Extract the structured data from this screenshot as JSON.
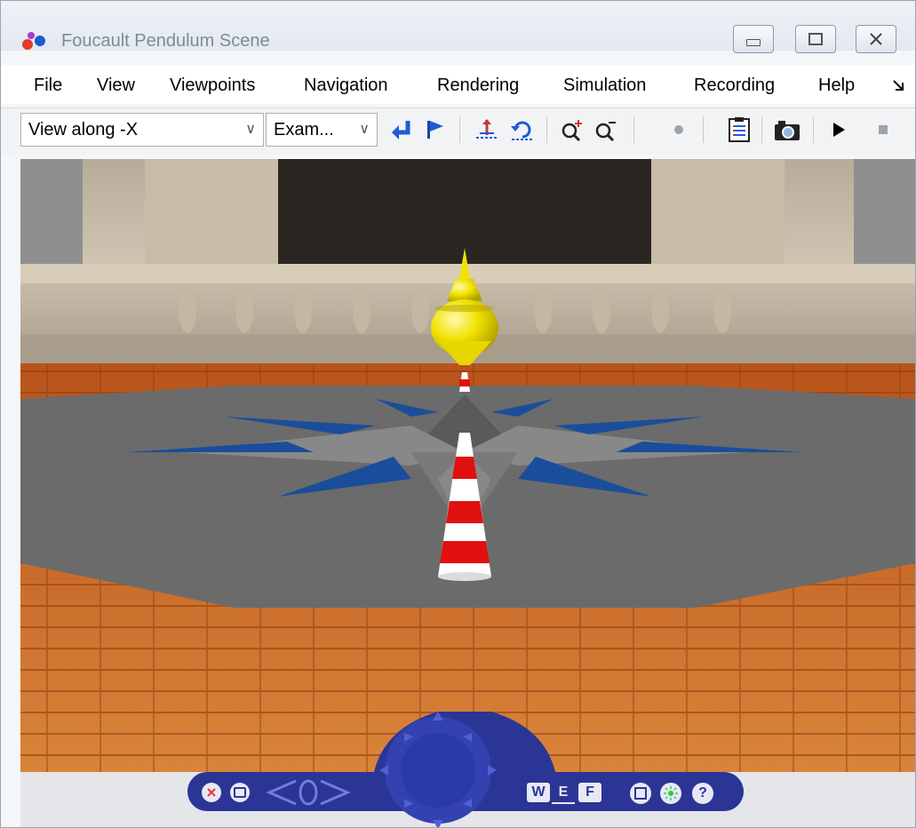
{
  "window": {
    "title": "Foucault Pendulum Scene"
  },
  "menu": {
    "items": [
      "File",
      "View",
      "Viewpoints",
      "Navigation",
      "Rendering",
      "Simulation",
      "Recording",
      "Help"
    ],
    "overflow_icon": "double-chevron-icon"
  },
  "toolbar": {
    "viewpoint_combo": "View along -X",
    "nav_mode_combo": "Exam...",
    "buttons": [
      "return-to-viewpoint",
      "create-viewpoint",
      "straighten-up",
      "undo-move",
      "zoom-in",
      "zoom-out",
      "record",
      "block-diagram",
      "capture-frame",
      "start-simulation",
      "stop-simulation"
    ]
  },
  "navigation_panel": {
    "buttons": [
      "close",
      "minimize",
      "rotate-left",
      "rotate-right",
      "w",
      "e",
      "f",
      "frame",
      "headlight",
      "help"
    ],
    "letters": {
      "w": "W",
      "e": "E",
      "f": "F",
      "help": "?"
    }
  },
  "colors": {
    "window_border": "#9aa4b0",
    "toolbar_blue": "#1f5bd6",
    "nav_panel": "#2b3596",
    "floor": "#c8641e",
    "platform": "#6b6b6b",
    "bob": "#f2e200"
  }
}
